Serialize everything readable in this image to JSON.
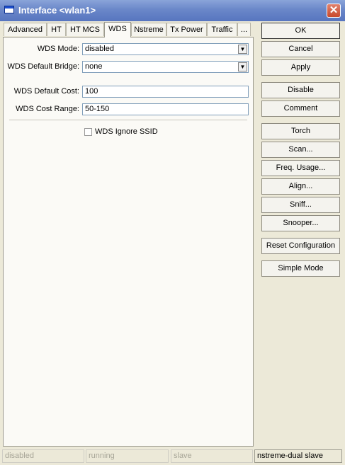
{
  "window": {
    "title": "Interface <wlan1>",
    "close_label": "✕"
  },
  "tabs": [
    "Advanced",
    "HT",
    "HT MCS",
    "WDS",
    "Nstreme",
    "Tx Power",
    "Traffic",
    "..."
  ],
  "active_tab": "WDS",
  "form": {
    "wds_mode": {
      "label": "WDS Mode:",
      "value": "disabled"
    },
    "wds_default_bridge": {
      "label": "WDS Default Bridge:",
      "value": "none"
    },
    "wds_default_cost": {
      "label": "WDS Default Cost:",
      "value": "100"
    },
    "wds_cost_range": {
      "label": "WDS Cost Range:",
      "value": "50-150"
    },
    "wds_ignore_ssid": {
      "label": "WDS Ignore SSID",
      "checked": false
    }
  },
  "buttons": {
    "ok": "OK",
    "cancel": "Cancel",
    "apply": "Apply",
    "disable": "Disable",
    "comment": "Comment",
    "torch": "Torch",
    "scan": "Scan...",
    "freq_usage": "Freq. Usage...",
    "align": "Align...",
    "sniff": "Sniff...",
    "snooper": "Snooper...",
    "reset_configuration": "Reset Configuration",
    "simple_mode": "Simple Mode"
  },
  "status": {
    "state": "disabled",
    "running": "running",
    "slave": "slave",
    "mode": "nstreme-dual slave"
  },
  "icons": {
    "window": "window-icon",
    "dropdown": "dropdown-arrow-icon",
    "close": "close-icon"
  }
}
